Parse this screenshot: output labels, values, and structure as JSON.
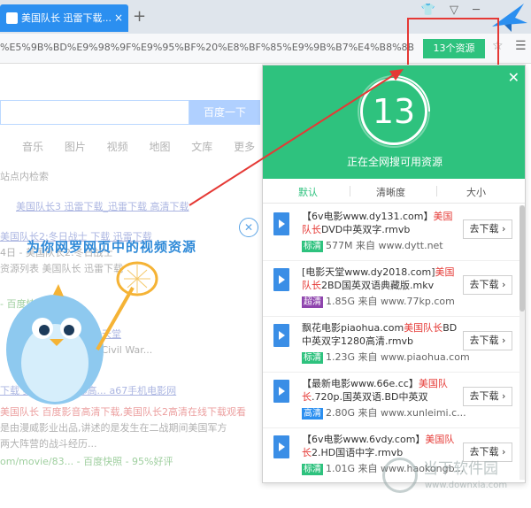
{
  "tab": {
    "title": "美国队长 迅雷下载...",
    "close": "×"
  },
  "newtab": "+",
  "window_controls": "👕 ▽ ─",
  "address": {
    "url": "%E5%9B%BD%E9%98%9F%E9%95%BF%20%E8%BF%85%E9%9B%B7%E4%B8%8B"
  },
  "resource_button": "13个资源",
  "background": {
    "search_button": "百度一下",
    "nav": "音乐 图片 视频 地图 文库 更多",
    "lines": [
      "站点内检索",
      "美国队长3 迅雷下载_迅雷下载 高清下载",
      "美国队长2:冬日战士 下载 迅雷下载",
      "4日 - 美国队长2:冬日战士",
      "资源列表 美国队长 迅雷下载",
      "- 百度快照 - 评价",
      "美国队长 - 天堂",
      "美国队长3 Civil War...",
      "下载 美国队长1-2部高... a67手机电影网",
      "美国队长 百度影音高清下载,美国队长2高清在线下载观看",
      "是由漫威影业出品,讲述的是发生在二战期间美国军方",
      "两大阵营的战斗经历...",
      "om/movie/83... - 百度快照 - 95%好评"
    ]
  },
  "promo": {
    "text": "为你网罗网页中的视频资源",
    "close": "✕"
  },
  "panel": {
    "count": "13",
    "status": "正在全网搜可用资源",
    "close": "✕",
    "sort_tabs": [
      "默认",
      "清晰度",
      "大小"
    ],
    "download_label": "去下载 ›",
    "items": [
      {
        "title_a": "【6v电影www.dy131.com】",
        "title_hl": "美国队长",
        "title_b": "DVD中英双字.rmvb",
        "badge": "标清",
        "badge_color": "#2ec27e",
        "meta": "577M 来自 www.dytt.net"
      },
      {
        "title_a": "[电影天堂www.dy2018.com]",
        "title_hl": "美国队长",
        "title_b": "2BD国英双语典藏版.mkv",
        "badge": "超清",
        "badge_color": "#8e44ad",
        "meta": "1.85G 来自 www.77kp.com"
      },
      {
        "title_a": "飘花电影piaohua.com",
        "title_hl": "美国队长",
        "title_b": "BD中英双字1280高清.rmvb",
        "badge": "标清",
        "badge_color": "#2ec27e",
        "meta": "1.23G 来自 www.piaohua.com"
      },
      {
        "title_a": "【最新电影www.66e.cc】",
        "title_hl": "美国队长",
        "title_b": ".720p.国英双语.BD中英双字.mkv",
        "badge": "高清",
        "badge_color": "#2b8ff0",
        "meta": "2.80G 来自 www.xunleimi.c..."
      },
      {
        "title_a": "【6v电影www.6vdy.com】",
        "title_hl": "美国队长",
        "title_b": "2.HD国语中字.rmvb",
        "badge": "标清",
        "badge_color": "#2ec27e",
        "meta": "1.01G 来自 www.haokongb..."
      }
    ]
  },
  "watermark": {
    "name": "当下软件园",
    "url": "www.downxia.com"
  },
  "colors": {
    "accent_green": "#2ec27e",
    "tab_blue": "#2b8ff0",
    "highlight_red": "#e53935"
  }
}
